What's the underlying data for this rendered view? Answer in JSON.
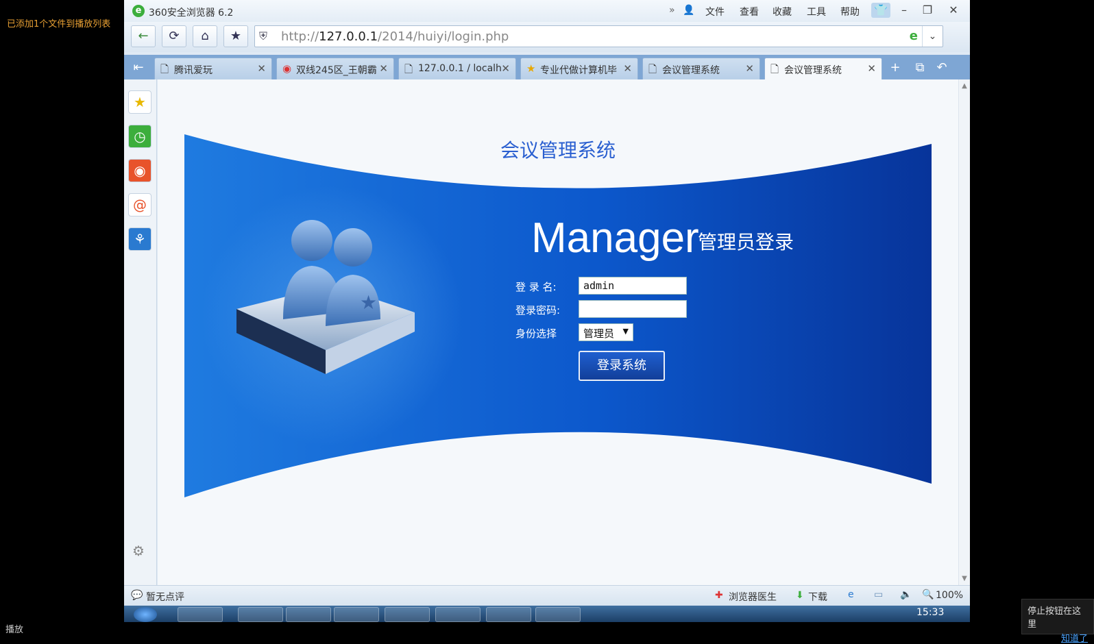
{
  "player": {
    "notice": "已添加1个文件到播放列表",
    "play_label": "播放",
    "tip_text": "停止按钮在这里",
    "tip_link": "知道了"
  },
  "browser": {
    "title": "360安全浏览器 6.2",
    "menu": [
      "文件",
      "查看",
      "收藏",
      "工具",
      "帮助"
    ],
    "url_prefix": "http://",
    "url_host": "127.0.0.1",
    "url_path": "/2014/huiyi/login.php",
    "tabs": [
      {
        "label": "腾讯爱玩",
        "icon": "page-icon"
      },
      {
        "label": "双线245区_王朝霸",
        "icon": "chrome-icon"
      },
      {
        "label": "127.0.0.1 / localh",
        "icon": "page-icon"
      },
      {
        "label": "专业代做计算机毕",
        "icon": "star-icon"
      },
      {
        "label": "会议管理系统",
        "icon": "page-icon"
      },
      {
        "label": "会议管理系统",
        "icon": "page-icon",
        "active": true
      }
    ],
    "status_left": "暂无点评",
    "status_doctor": "浏览器医生",
    "status_download": "下载",
    "zoom": "100%",
    "clock": "15:33"
  },
  "page": {
    "title": "会议管理系统",
    "logo_word": "Manager",
    "logo_sub": "管理员登录",
    "username_label": "登 录 名:",
    "username_value": "admin",
    "password_label": "登录密码:",
    "password_value": "",
    "role_label": "身份选择",
    "role_value": "管理员",
    "login_button": "登录系统"
  },
  "colors": {
    "panel_blue": "#0a4fc8",
    "title_blue": "#2a5fd0",
    "tabbar": "#7ea6d4"
  }
}
